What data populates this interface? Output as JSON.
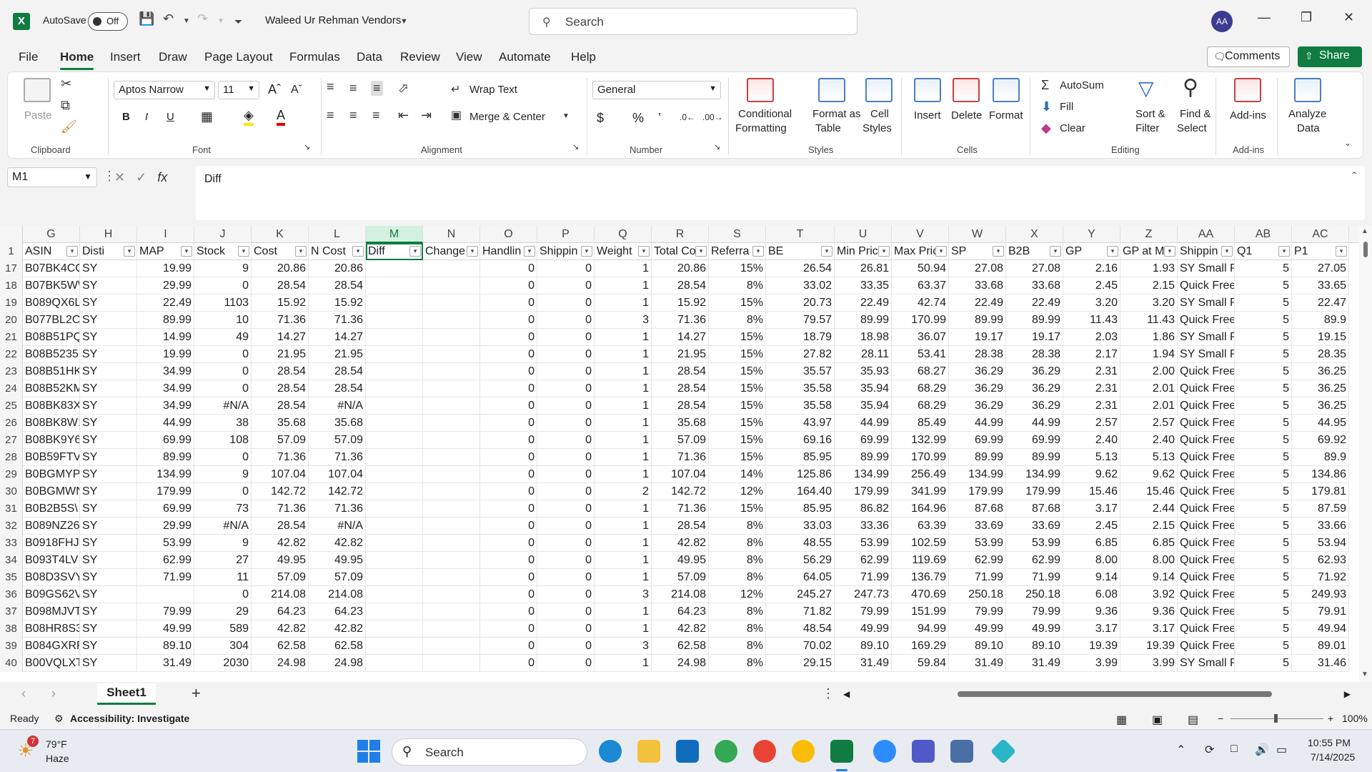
{
  "titlebar": {
    "autosave_label": "AutoSave",
    "autosave_state": "Off",
    "doc_title": "Waleed Ur Rehman Vendors",
    "search_placeholder": "Search",
    "avatar_initials": "AA"
  },
  "menu": [
    "File",
    "Home",
    "Insert",
    "Draw",
    "Page Layout",
    "Formulas",
    "Data",
    "Review",
    "View",
    "Automate",
    "Help"
  ],
  "menu_active": "Home",
  "actions": {
    "comments": "Comments",
    "share": "Share"
  },
  "ribbon": {
    "clipboard": {
      "paste": "Paste",
      "label": "Clipboard"
    },
    "font": {
      "family": "Aptos Narrow",
      "size": "11",
      "label": "Font"
    },
    "alignment": {
      "wrap": "Wrap Text",
      "merge": "Merge & Center",
      "label": "Alignment"
    },
    "number": {
      "format": "General",
      "label": "Number"
    },
    "styles": {
      "cond1": "Conditional",
      "cond2": "Formatting",
      "fmt1": "Format as",
      "fmt2": "Table",
      "cell1": "Cell",
      "cell2": "Styles",
      "label": "Styles"
    },
    "cells": {
      "insert": "Insert",
      "delete": "Delete",
      "format": "Format",
      "label": "Cells"
    },
    "editing": {
      "autosum": "AutoSum",
      "fill": "Fill",
      "clear": "Clear",
      "sort1": "Sort &",
      "sort2": "Filter",
      "find1": "Find &",
      "find2": "Select",
      "label": "Editing"
    },
    "addins": {
      "addins": "Add-ins",
      "label": "Add-ins"
    },
    "analyze": {
      "l1": "Analyze",
      "l2": "Data"
    }
  },
  "formula": {
    "name_box": "M1",
    "content": "Diff"
  },
  "columns": [
    "G",
    "H",
    "I",
    "J",
    "K",
    "L",
    "M",
    "N",
    "O",
    "P",
    "Q",
    "R",
    "S",
    "T",
    "U",
    "V",
    "W",
    "X",
    "Y",
    "Z",
    "AA",
    "AB",
    "AC"
  ],
  "selected_column": "M",
  "header_row": [
    "ASIN",
    "Disti",
    "MAP",
    "Stock",
    "Cost",
    "N Cost",
    "Diff",
    "Change",
    "Handlin",
    "Shippin",
    "Weight",
    "Total Co",
    "Referra",
    "BE",
    "Min Pric",
    "Max Pric",
    "SP",
    "B2B",
    "GP",
    "GP at M",
    "Shippin",
    "Q1",
    "P1"
  ],
  "rows": [
    {
      "n": "17",
      "c": [
        "B07BK4CC",
        "SY",
        "19.99",
        "9",
        "20.86",
        "20.86",
        "",
        "",
        "0",
        "0",
        "1",
        "20.86",
        "15%",
        "26.54",
        "26.81",
        "50.94",
        "27.08",
        "27.08",
        "2.16",
        "1.93",
        "SY Small Pa",
        "5",
        "27.05"
      ]
    },
    {
      "n": "18",
      "c": [
        "B07BK5W\\",
        "SY",
        "29.99",
        "0",
        "28.54",
        "28.54",
        "",
        "",
        "0",
        "0",
        "1",
        "28.54",
        "8%",
        "33.02",
        "33.35",
        "63.37",
        "33.68",
        "33.68",
        "2.45",
        "2.15",
        "Quick Free",
        "5",
        "33.65"
      ]
    },
    {
      "n": "19",
      "c": [
        "B089QX6L",
        "SY",
        "22.49",
        "1103",
        "15.92",
        "15.92",
        "",
        "",
        "0",
        "0",
        "1",
        "15.92",
        "15%",
        "20.73",
        "22.49",
        "42.74",
        "22.49",
        "22.49",
        "3.20",
        "3.20",
        "SY Small Pa",
        "5",
        "22.47"
      ]
    },
    {
      "n": "20",
      "c": [
        "B077BL2C",
        "SY",
        "89.99",
        "10",
        "71.36",
        "71.36",
        "",
        "",
        "0",
        "0",
        "3",
        "71.36",
        "8%",
        "79.57",
        "89.99",
        "170.99",
        "89.99",
        "89.99",
        "11.43",
        "11.43",
        "Quick Free",
        "5",
        "89.9"
      ]
    },
    {
      "n": "21",
      "c": [
        "B08B51PQ",
        "SY",
        "14.99",
        "49",
        "14.27",
        "14.27",
        "",
        "",
        "0",
        "0",
        "1",
        "14.27",
        "15%",
        "18.79",
        "18.98",
        "36.07",
        "19.17",
        "19.17",
        "2.03",
        "1.86",
        "SY Small Pa",
        "5",
        "19.15"
      ]
    },
    {
      "n": "22",
      "c": [
        "B08B5235",
        "SY",
        "19.99",
        "0",
        "21.95",
        "21.95",
        "",
        "",
        "0",
        "0",
        "1",
        "21.95",
        "15%",
        "27.82",
        "28.11",
        "53.41",
        "28.38",
        "28.38",
        "2.17",
        "1.94",
        "SY Small Pa",
        "5",
        "28.35"
      ]
    },
    {
      "n": "23",
      "c": [
        "B08B51HK",
        "SY",
        "34.99",
        "0",
        "28.54",
        "28.54",
        "",
        "",
        "0",
        "0",
        "1",
        "28.54",
        "15%",
        "35.57",
        "35.93",
        "68.27",
        "36.29",
        "36.29",
        "2.31",
        "2.00",
        "Quick Free",
        "5",
        "36.25"
      ]
    },
    {
      "n": "24",
      "c": [
        "B08B52KM",
        "SY",
        "34.99",
        "0",
        "28.54",
        "28.54",
        "",
        "",
        "0",
        "0",
        "1",
        "28.54",
        "15%",
        "35.58",
        "35.94",
        "68.29",
        "36.29",
        "36.29",
        "2.31",
        "2.01",
        "Quick Free",
        "5",
        "36.25"
      ]
    },
    {
      "n": "25",
      "c": [
        "B08BK83X",
        "SY",
        "34.99",
        "#N/A",
        "28.54",
        "#N/A",
        "",
        "",
        "0",
        "0",
        "1",
        "28.54",
        "15%",
        "35.58",
        "35.94",
        "68.29",
        "36.29",
        "36.29",
        "2.31",
        "2.01",
        "Quick Free",
        "5",
        "36.25"
      ]
    },
    {
      "n": "26",
      "c": [
        "B08BK8W1",
        "SY",
        "44.99",
        "38",
        "35.68",
        "35.68",
        "",
        "",
        "0",
        "0",
        "1",
        "35.68",
        "15%",
        "43.97",
        "44.99",
        "85.49",
        "44.99",
        "44.99",
        "2.57",
        "2.57",
        "Quick Free",
        "5",
        "44.95"
      ]
    },
    {
      "n": "27",
      "c": [
        "B08BK9Y6",
        "SY",
        "69.99",
        "108",
        "57.09",
        "57.09",
        "",
        "",
        "0",
        "0",
        "1",
        "57.09",
        "15%",
        "69.16",
        "69.99",
        "132.99",
        "69.99",
        "69.99",
        "2.40",
        "2.40",
        "Quick Free",
        "5",
        "69.92"
      ]
    },
    {
      "n": "28",
      "c": [
        "B0B59FTV",
        "SY",
        "89.99",
        "0",
        "71.36",
        "71.36",
        "",
        "",
        "0",
        "0",
        "1",
        "71.36",
        "15%",
        "85.95",
        "89.99",
        "170.99",
        "89.99",
        "89.99",
        "5.13",
        "5.13",
        "Quick Free",
        "5",
        "89.9"
      ]
    },
    {
      "n": "29",
      "c": [
        "B0BGMYP",
        "SY",
        "134.99",
        "9",
        "107.04",
        "107.04",
        "",
        "",
        "0",
        "0",
        "1",
        "107.04",
        "14%",
        "125.86",
        "134.99",
        "256.49",
        "134.99",
        "134.99",
        "9.62",
        "9.62",
        "Quick Free",
        "5",
        "134.86"
      ]
    },
    {
      "n": "30",
      "c": [
        "B0BGMWN",
        "SY",
        "179.99",
        "0",
        "142.72",
        "142.72",
        "",
        "",
        "0",
        "0",
        "2",
        "142.72",
        "12%",
        "164.40",
        "179.99",
        "341.99",
        "179.99",
        "179.99",
        "15.46",
        "15.46",
        "Quick Free",
        "5",
        "179.81"
      ]
    },
    {
      "n": "31",
      "c": [
        "B0B2B5S\\",
        "SY",
        "69.99",
        "73",
        "71.36",
        "71.36",
        "",
        "",
        "0",
        "0",
        "1",
        "71.36",
        "15%",
        "85.95",
        "86.82",
        "164.96",
        "87.68",
        "87.68",
        "3.17",
        "2.44",
        "Quick Free",
        "5",
        "87.59"
      ]
    },
    {
      "n": "32",
      "c": [
        "B089NZ26",
        "SY",
        "29.99",
        "#N/A",
        "28.54",
        "#N/A",
        "",
        "",
        "0",
        "0",
        "1",
        "28.54",
        "8%",
        "33.03",
        "33.36",
        "63.39",
        "33.69",
        "33.69",
        "2.45",
        "2.15",
        "Quick Free",
        "5",
        "33.66"
      ]
    },
    {
      "n": "33",
      "c": [
        "B0918FHJ",
        "SY",
        "53.99",
        "9",
        "42.82",
        "42.82",
        "",
        "",
        "0",
        "0",
        "1",
        "42.82",
        "8%",
        "48.55",
        "53.99",
        "102.59",
        "53.99",
        "53.99",
        "6.85",
        "6.85",
        "Quick Free",
        "5",
        "53.94"
      ]
    },
    {
      "n": "34",
      "c": [
        "B093T4LV",
        "SY",
        "62.99",
        "27",
        "49.95",
        "49.95",
        "",
        "",
        "0",
        "0",
        "1",
        "49.95",
        "8%",
        "56.29",
        "62.99",
        "119.69",
        "62.99",
        "62.99",
        "8.00",
        "8.00",
        "Quick Free",
        "5",
        "62.93"
      ]
    },
    {
      "n": "35",
      "c": [
        "B08D3SVY",
        "SY",
        "71.99",
        "11",
        "57.09",
        "57.09",
        "",
        "",
        "0",
        "0",
        "1",
        "57.09",
        "8%",
        "64.05",
        "71.99",
        "136.79",
        "71.99",
        "71.99",
        "9.14",
        "9.14",
        "Quick Free",
        "5",
        "71.92"
      ]
    },
    {
      "n": "36",
      "c": [
        "B09GS62V",
        "SY",
        "",
        "0",
        "214.08",
        "214.08",
        "",
        "",
        "0",
        "0",
        "3",
        "214.08",
        "12%",
        "245.27",
        "247.73",
        "470.69",
        "250.18",
        "250.18",
        "6.08",
        "3.92",
        "Quick Free",
        "5",
        "249.93"
      ]
    },
    {
      "n": "37",
      "c": [
        "B098MJVT",
        "SY",
        "79.99",
        "29",
        "64.23",
        "64.23",
        "",
        "",
        "0",
        "0",
        "1",
        "64.23",
        "8%",
        "71.82",
        "79.99",
        "151.99",
        "79.99",
        "79.99",
        "9.36",
        "9.36",
        "Quick Free",
        "5",
        "79.91"
      ]
    },
    {
      "n": "38",
      "c": [
        "B08HR8S3",
        "SY",
        "49.99",
        "589",
        "42.82",
        "42.82",
        "",
        "",
        "0",
        "0",
        "1",
        "42.82",
        "8%",
        "48.54",
        "49.99",
        "94.99",
        "49.99",
        "49.99",
        "3.17",
        "3.17",
        "Quick Free",
        "5",
        "49.94"
      ]
    },
    {
      "n": "39",
      "c": [
        "B084GXRF",
        "SY",
        "89.10",
        "304",
        "62.58",
        "62.58",
        "",
        "",
        "0",
        "0",
        "3",
        "62.58",
        "8%",
        "70.02",
        "89.10",
        "169.29",
        "89.10",
        "89.10",
        "19.39",
        "19.39",
        "Quick Free",
        "5",
        "89.01"
      ]
    },
    {
      "n": "40",
      "c": [
        "B00VQLXT",
        "SY",
        "31.49",
        "2030",
        "24.98",
        "24.98",
        "",
        "",
        "0",
        "0",
        "1",
        "24.98",
        "8%",
        "29.15",
        "31.49",
        "59.84",
        "31.49",
        "31.49",
        "3.99",
        "3.99",
        "SY Small Pa",
        "5",
        "31.46"
      ]
    }
  ],
  "sheet": {
    "tab": "Sheet1"
  },
  "status": {
    "ready": "Ready",
    "accessibility": "Accessibility: Investigate",
    "zoom": "100%"
  },
  "taskbar": {
    "temp": "79°F",
    "weather": "Haze",
    "search": "Search",
    "time": "10:55 PM",
    "date": "7/14/2025",
    "weather_badge": "7"
  }
}
